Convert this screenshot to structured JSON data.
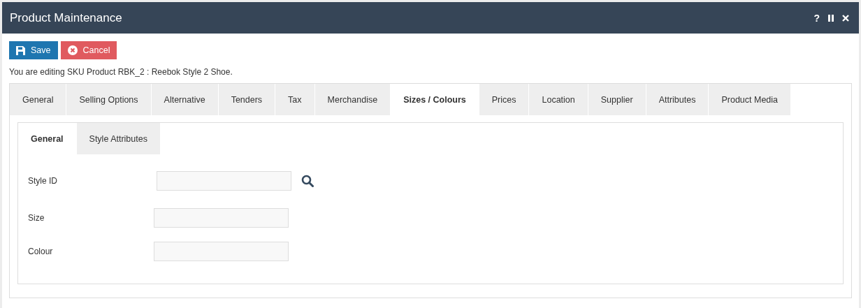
{
  "window": {
    "title": "Product Maintenance",
    "controls": [
      {
        "kind": "help",
        "label": "?"
      },
      {
        "kind": "pause"
      },
      {
        "kind": "close"
      }
    ]
  },
  "buttons": [
    {
      "kind": "save",
      "label": "Save"
    },
    {
      "kind": "cancel",
      "label": "Cancel"
    }
  ],
  "message": "You are editing SKU Product RBK_2 : Reebok Style 2 Shoe.",
  "tabs": [
    {
      "label": "General",
      "selected": false
    },
    {
      "label": "Selling Options",
      "selected": false
    },
    {
      "label": "Alternative",
      "selected": false
    },
    {
      "label": "Tenders",
      "selected": false
    },
    {
      "label": "Tax",
      "selected": false
    },
    {
      "label": "Merchandise",
      "selected": false
    },
    {
      "label": "Sizes / Colours",
      "selected": true
    },
    {
      "label": "Prices",
      "selected": false
    },
    {
      "label": "Location",
      "selected": false
    },
    {
      "label": "Supplier",
      "selected": false
    },
    {
      "label": "Attributes",
      "selected": false
    },
    {
      "label": "Product Media",
      "selected": false
    }
  ],
  "sub_tabs": [
    {
      "label": "General",
      "selected": true
    },
    {
      "label": "Style Attributes",
      "selected": false
    }
  ],
  "fields": [
    {
      "label": "Style ID",
      "lookup": true
    },
    {
      "label": "Size",
      "lookup": false
    },
    {
      "label": "Colour",
      "lookup": false
    }
  ]
}
